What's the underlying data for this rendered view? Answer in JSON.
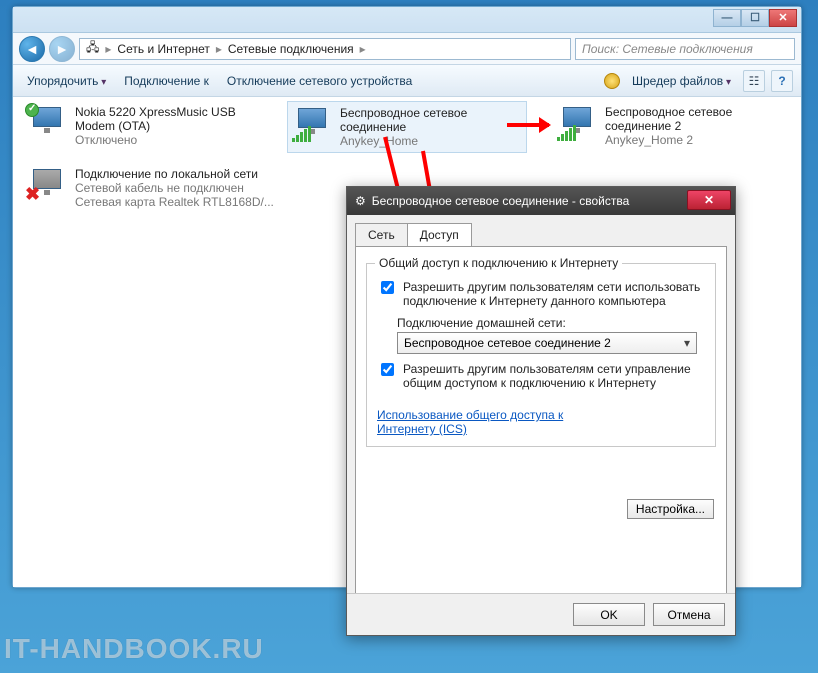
{
  "window": {
    "min": "—",
    "max": "☐",
    "close": "✕"
  },
  "breadcrumb": {
    "icon": "🖧",
    "level1": "Сеть и Интернет",
    "level2": "Сетевые подключения"
  },
  "search": {
    "placeholder": "Поиск: Сетевые подключения"
  },
  "toolbar": {
    "organize": "Упорядочить",
    "connect": "Подключение к",
    "disable": "Отключение сетевого устройства",
    "shredder": "Шредер файлов"
  },
  "connections": {
    "c1": {
      "title1": "Nokia 5220 XpressMusic USB",
      "title2": "Modem (OTA)",
      "status": "Отключено"
    },
    "c2": {
      "title1": "Беспроводное сетевое",
      "title2": "соединение",
      "status": "Anykey_Home"
    },
    "c3": {
      "title1": "Беспроводное сетевое",
      "title2": "соединение 2",
      "status": "Anykey_Home 2"
    },
    "c4": {
      "title": "Подключение по локальной сети",
      "line2": "Сетевой кабель не подключен",
      "line3": "Сетевая карта Realtek RTL8168D/..."
    }
  },
  "dialog": {
    "title": "Беспроводное сетевое соединение - свойства",
    "tabs": {
      "network": "Сеть",
      "sharing": "Доступ"
    },
    "group_title": "Общий доступ к подключению к Интернету",
    "chk1": "Разрешить другим пользователям сети использовать подключение к Интернету данного компьютера",
    "combo_label": "Подключение домашней сети:",
    "combo_value": "Беспроводное сетевое соединение 2",
    "chk2": "Разрешить другим пользователям сети управление общим доступом к подключению к Интернету",
    "link1": "Использование общего доступа к",
    "link2": "Интернету (ICS)",
    "config_btn": "Настройка...",
    "ok": "OK",
    "cancel": "Отмена"
  },
  "watermark": "IT-HANDBOOK.RU"
}
